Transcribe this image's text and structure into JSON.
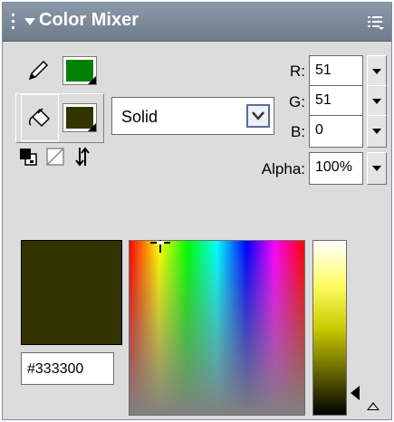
{
  "panel": {
    "title": "Color Mixer",
    "icons": {
      "gripper": "gripper-icon",
      "collapse": "collapse-arrow-icon",
      "options_menu": "options-menu-icon"
    }
  },
  "stroke": {
    "icon": "pencil-icon",
    "color": "#008000"
  },
  "fill": {
    "icon": "paint-bucket-icon",
    "color": "#333300"
  },
  "fill_type": {
    "selected": "Solid"
  },
  "buttons": {
    "black_white": "black-and-white-icon",
    "no_color": "no-color-icon",
    "swap_colors": "swap-colors-icon"
  },
  "rgb": {
    "r_label": "R:",
    "r_value": "51",
    "g_label": "G:",
    "g_value": "51",
    "b_label": "B:",
    "b_value": "0"
  },
  "alpha": {
    "label": "Alpha:",
    "value": "100%"
  },
  "preview": {
    "color": "#333300",
    "hex": "#333300"
  },
  "spectrum": {
    "icon": "crosshair-icon"
  },
  "brightness": {
    "pointer_icon": "slider-pointer-icon",
    "toggle_icon": "expand-triangle-icon"
  }
}
